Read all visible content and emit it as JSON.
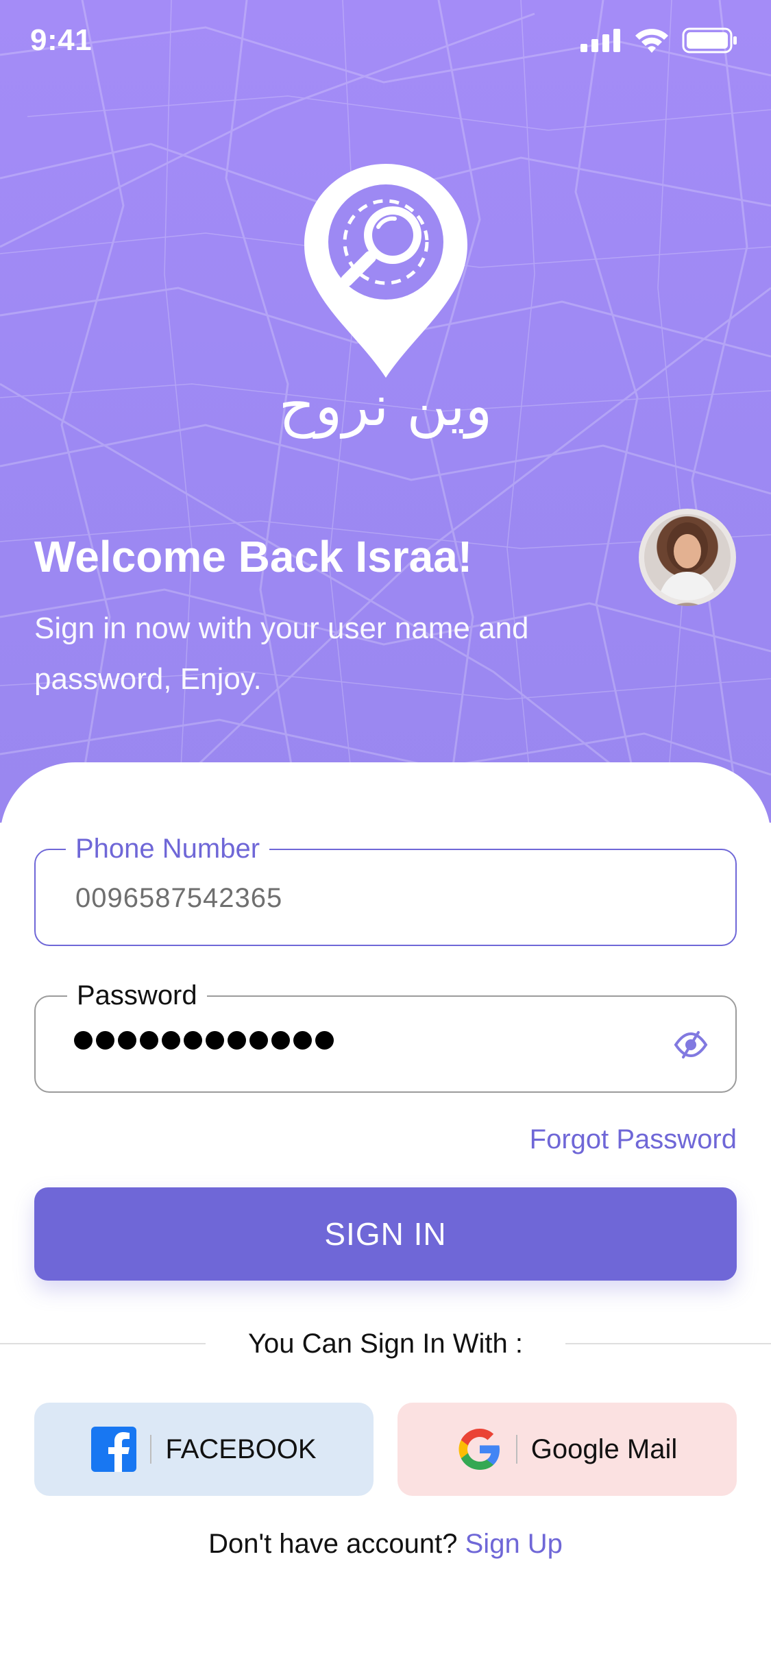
{
  "status_bar": {
    "time": "9:41"
  },
  "brand": {
    "arabic_name": "وين نروح"
  },
  "welcome": {
    "title": "Welcome Back Israa!",
    "subtitle_line1": "Sign in now with your user name and",
    "subtitle_line2": "password, Enjoy."
  },
  "form": {
    "phone": {
      "label": "Phone Number",
      "value": "0096587542365"
    },
    "password": {
      "label": "Password",
      "masked_length": 12
    },
    "forgot_label": "Forgot Password",
    "sign_in_label": "SIGN IN"
  },
  "social": {
    "divider_text": "You Can Sign In With :",
    "facebook_label": "FACEBOOK",
    "google_label": "Google Mail"
  },
  "footer": {
    "prompt": "Don't have account?",
    "signup_label": "Sign Up"
  },
  "colors": {
    "accent": "#6f67d7",
    "hero_top": "#a48cf7",
    "facebook_bg": "#dce8f6",
    "google_bg": "#fbe1e1"
  }
}
